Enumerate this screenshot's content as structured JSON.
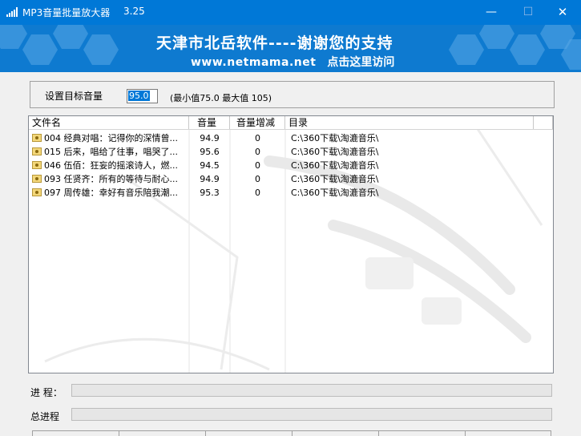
{
  "window": {
    "title": "MP3音量批量放大器",
    "version": "3.25",
    "min_glyph": "—",
    "max_glyph": "☐",
    "close_glyph": "✕"
  },
  "banner": {
    "line1": "天津市北岳软件----谢谢您的支持",
    "site": "www.netmama.net",
    "link": "点击这里访问"
  },
  "target": {
    "label": "设置目标音量",
    "value": "95.0",
    "hint": "(最小值75.0  最大值 105)"
  },
  "table": {
    "columns": [
      "文件名",
      "音量",
      "音量增减",
      "目录"
    ],
    "rows": [
      {
        "name": "004 经典对唱：记得你的深情曾...",
        "volume": "94.9",
        "gain": "0",
        "dir": "C:\\360下载\\淘漉音乐\\"
      },
      {
        "name": "015 后来，唱给了往事，唱哭了...",
        "volume": "95.6",
        "gain": "0",
        "dir": "C:\\360下载\\淘漉音乐\\"
      },
      {
        "name": "046 伍佰：狂妄的摇滚诗人，燃...",
        "volume": "94.5",
        "gain": "0",
        "dir": "C:\\360下载\\淘漉音乐\\"
      },
      {
        "name": "093 任贤齐：所有的等待与耐心...",
        "volume": "94.9",
        "gain": "0",
        "dir": "C:\\360下载\\淘漉音乐\\"
      },
      {
        "name": "097 周传雄：幸好有音乐陪我潮...",
        "volume": "95.3",
        "gain": "0",
        "dir": "C:\\360下载\\淘漉音乐\\"
      }
    ]
  },
  "progress": {
    "current_label": "进  程：",
    "current_value": 0,
    "total_label": "总进程",
    "total_value": 0
  },
  "icons": {
    "app": "signal-bars-icon",
    "file": "music-file-icon"
  },
  "colors": {
    "titlebar": "#0078d7",
    "banner": "#0e7ad0",
    "selection": "#0078d7"
  }
}
